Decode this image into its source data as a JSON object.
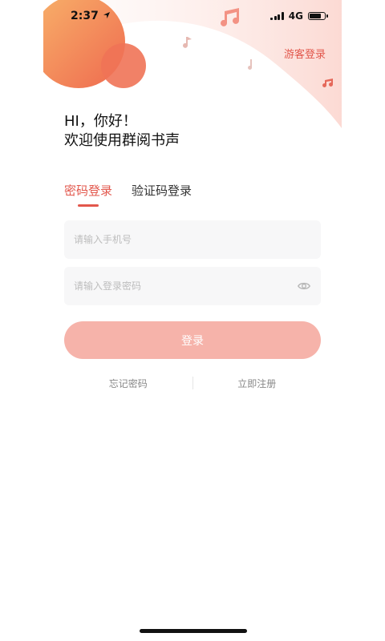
{
  "status_bar": {
    "time": "2:37",
    "network": "4G",
    "battery_level": 0.75
  },
  "header": {
    "guest_login_label": "游客登录"
  },
  "greeting": {
    "line1": "HI，你好！",
    "line2": "欢迎使用群阅书声"
  },
  "tabs": [
    {
      "label": "密码登录",
      "active": true
    },
    {
      "label": "验证码登录",
      "active": false
    }
  ],
  "form": {
    "phone_placeholder": "请输入手机号",
    "phone_value": "",
    "password_placeholder": "请输入登录密码",
    "password_value": "",
    "login_label": "登录"
  },
  "links": {
    "forgot_password": "忘记密码",
    "register": "立即注册"
  },
  "icons": {
    "eye": "eye-icon",
    "music_note": "music-note-icon",
    "location_arrow": "location-arrow-icon"
  },
  "colors": {
    "accent": "#e2574c",
    "button": "#f6b3aa",
    "field_bg": "#f7f7f8"
  }
}
